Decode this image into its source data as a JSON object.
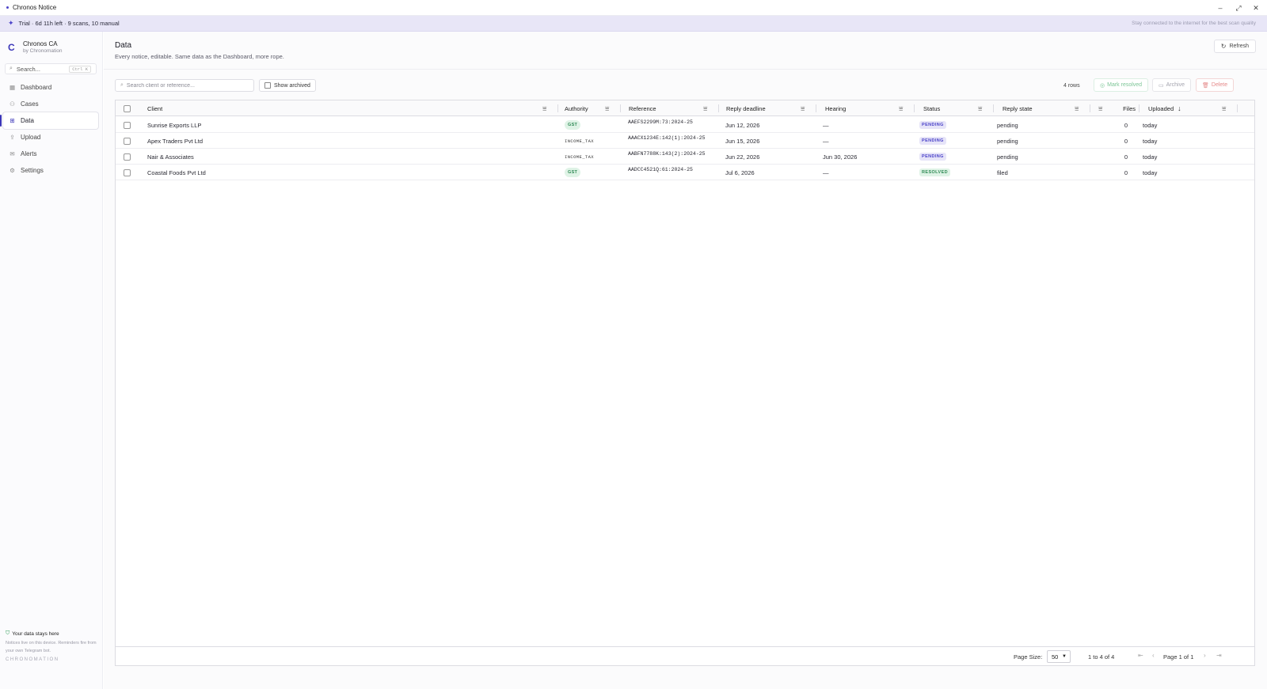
{
  "window": {
    "title": "Chronos Notice",
    "minimize": "–",
    "maximize": "⤢",
    "close": "✕"
  },
  "banner": {
    "trial": "Trial · 6d 11h left · 9 scans, 10 manual",
    "hint": "Stay connected to the internet for the best scan quality"
  },
  "sidebar": {
    "brand_name": "Chronos CA",
    "brand_sub": "by Chronomation",
    "search_placeholder": "Search...",
    "search_shortcut": "Ctrl K",
    "items": [
      {
        "label": "Dashboard",
        "icon": "dashboard-icon",
        "glyph": "▦"
      },
      {
        "label": "Cases",
        "icon": "users-icon",
        "glyph": "⚇"
      },
      {
        "label": "Data",
        "icon": "table-icon",
        "glyph": "⊞"
      },
      {
        "label": "Upload",
        "icon": "upload-icon",
        "glyph": "⇪"
      },
      {
        "label": "Alerts",
        "icon": "mail-icon",
        "glyph": "✉"
      },
      {
        "label": "Settings",
        "icon": "gear-icon",
        "glyph": "⚙"
      }
    ],
    "active_index": 2,
    "footer_title": "Your data stays here",
    "footer_desc": "Notices live on this device. Reminders fire from your own Telegram bot.",
    "footer_mark": "CHRONOMATION"
  },
  "main": {
    "title": "Data",
    "subtitle": "Every notice, editable. Same data as the Dashboard, more rope.",
    "refresh_label": "Refresh",
    "search_placeholder": "Search client or reference...",
    "show_archived_label": "Show archived",
    "row_count": "4 rows",
    "mark_resolved_label": "Mark resolved",
    "archive_label": "Archive",
    "delete_label": "Delete"
  },
  "grid": {
    "columns": [
      "Client",
      "Authority",
      "Reference",
      "Reply deadline",
      "Hearing",
      "Status",
      "Reply state",
      "Files",
      "Uploaded"
    ],
    "sort_indicator": "↓",
    "rows": [
      {
        "client": "Sunrise Exports LLP",
        "authority": "GST",
        "reference": "AAEFS2299M:73:2024-25",
        "deadline": "Jun 12, 2026",
        "hearing": "—",
        "status": "PENDING",
        "reply_state": "pending",
        "files": "0",
        "uploaded": "today"
      },
      {
        "client": "Apex Traders Pvt Ltd",
        "authority": "INCOME_TAX",
        "reference": "AAACX1234E:142(1):2024-25",
        "deadline": "Jun 15, 2026",
        "hearing": "—",
        "status": "PENDING",
        "reply_state": "pending",
        "files": "0",
        "uploaded": "today"
      },
      {
        "client": "Nair & Associates",
        "authority": "INCOME_TAX",
        "reference": "AABFN7788K:143(2):2024-25",
        "deadline": "Jun 22, 2026",
        "hearing": "Jun 30, 2026",
        "status": "PENDING",
        "reply_state": "pending",
        "files": "0",
        "uploaded": "today"
      },
      {
        "client": "Coastal Foods Pvt Ltd",
        "authority": "GST",
        "reference": "AADCC4521Q:61:2024-25",
        "deadline": "Jul 6, 2026",
        "hearing": "—",
        "status": "RESOLVED",
        "reply_state": "filed",
        "files": "0",
        "uploaded": "today"
      }
    ],
    "page_size_label": "Page Size:",
    "page_size_value": "50",
    "range_text": "1 to 4 of 4",
    "page_text": "Page 1 of 1"
  },
  "colors": {
    "accent": "#3b36b8",
    "pending": "#4b43c9",
    "resolved": "#2f8a55",
    "banner_bg": "#e8e6f7"
  }
}
